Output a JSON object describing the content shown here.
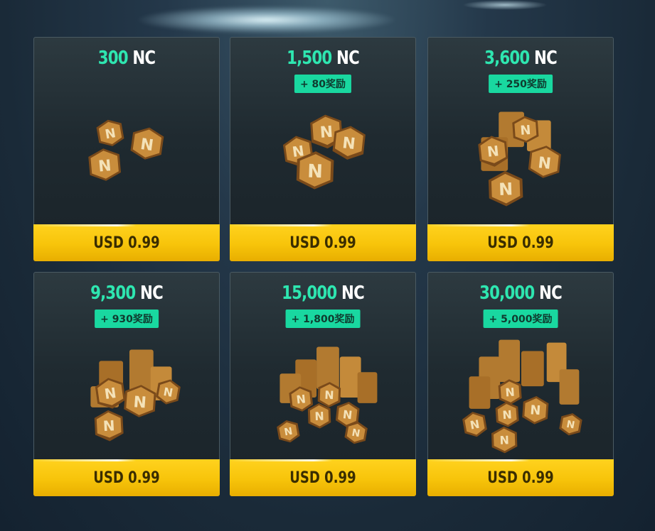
{
  "currency_unit": "NC",
  "cards": [
    {
      "amount": "300",
      "unit": "NC",
      "bonus": "",
      "price": "USD 0.99",
      "coin_pile_icon": "coin-pile-small-icon"
    },
    {
      "amount": "1,500",
      "unit": "NC",
      "bonus": "+ 80奖励",
      "price": "USD 0.99",
      "coin_pile_icon": "coin-pile-small-icon"
    },
    {
      "amount": "3,600",
      "unit": "NC",
      "bonus": "+ 250奖励",
      "price": "USD 0.99",
      "coin_pile_icon": "coin-pile-medium-icon"
    },
    {
      "amount": "9,300",
      "unit": "NC",
      "bonus": "+ 930奖励",
      "price": "USD 0.99",
      "coin_pile_icon": "coin-pile-medium-icon"
    },
    {
      "amount": "15,000",
      "unit": "NC",
      "bonus": "+ 1,800奖励",
      "price": "USD 0.99",
      "coin_pile_icon": "coin-pile-large-icon"
    },
    {
      "amount": "30,000",
      "unit": "NC",
      "bonus": "+ 5,000奖励",
      "price": "USD 0.99",
      "coin_pile_icon": "coin-pile-large-icon"
    }
  ],
  "colors": {
    "amount_accent": "#2ee6b0",
    "bonus_badge": "#19d8a0",
    "price_button": "#f7c40a",
    "card_background": "#1f2a30"
  }
}
